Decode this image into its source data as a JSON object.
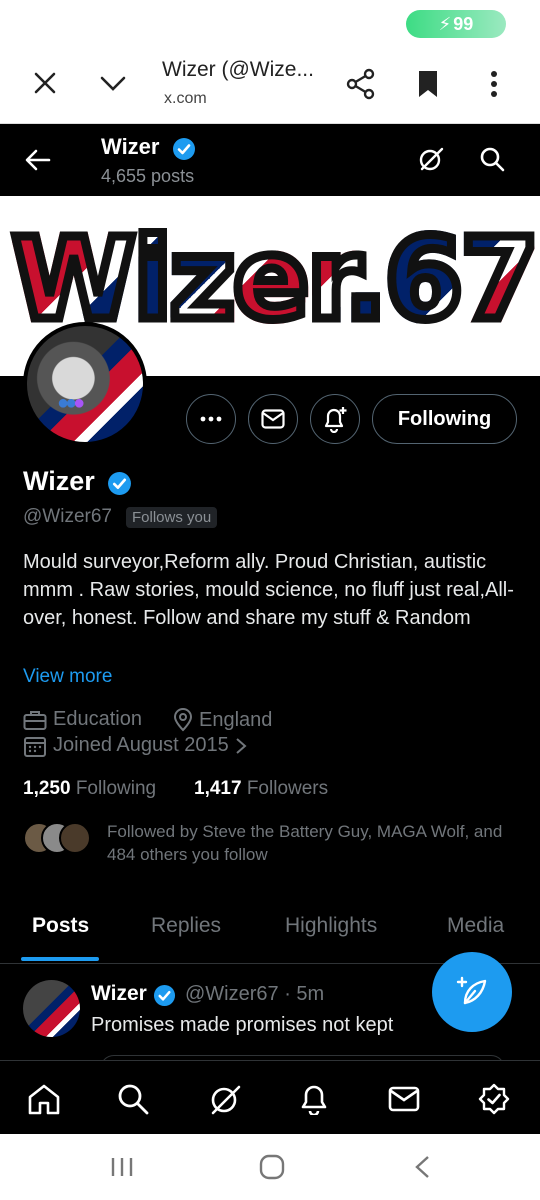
{
  "status": {
    "battery": "99"
  },
  "browser": {
    "title": "Wizer (@Wize...",
    "url": "x.com"
  },
  "header": {
    "name": "Wizer",
    "posts": "4,655 posts"
  },
  "banner": {
    "text": "Wizer.67"
  },
  "profile": {
    "name": "Wizer",
    "handle": "@Wizer67",
    "follows_you": "Follows you",
    "bio": "Mould surveyor,Reform ally. Proud Christian, autistic mmm . Raw stories, mould science, no fluff just real,All-over, honest. Follow and share my stuff & Random",
    "view_more": "View more",
    "category": "Education",
    "location": "England",
    "joined": "Joined August 2015",
    "following_count": "1,250",
    "following_label": "Following",
    "followers_count": "1,417",
    "followers_label": "Followers",
    "followed_by": "Followed by Steve the Battery Guy, MAGA Wolf, and 484 others you follow",
    "following_button": "Following"
  },
  "tabs": [
    "Posts",
    "Replies",
    "Highlights",
    "Media"
  ],
  "post": {
    "name": "Wizer",
    "handle_time": "@Wizer67 · 5m",
    "text": "Promises made promises not kept"
  },
  "colors": {
    "accent": "#1d9bf0",
    "background": "#000000",
    "muted": "#71767b"
  },
  "icons": [
    "close-icon",
    "chevron-down-icon",
    "share-icon",
    "bookmark-icon",
    "more-vertical-icon",
    "back-arrow-icon",
    "verified-badge-icon",
    "grok-icon",
    "search-icon",
    "more-horizontal-icon",
    "message-icon",
    "notification-plus-icon",
    "briefcase-icon",
    "location-icon",
    "calendar-icon",
    "compose-icon",
    "home-icon",
    "bell-icon",
    "mail-icon",
    "premium-icon"
  ]
}
